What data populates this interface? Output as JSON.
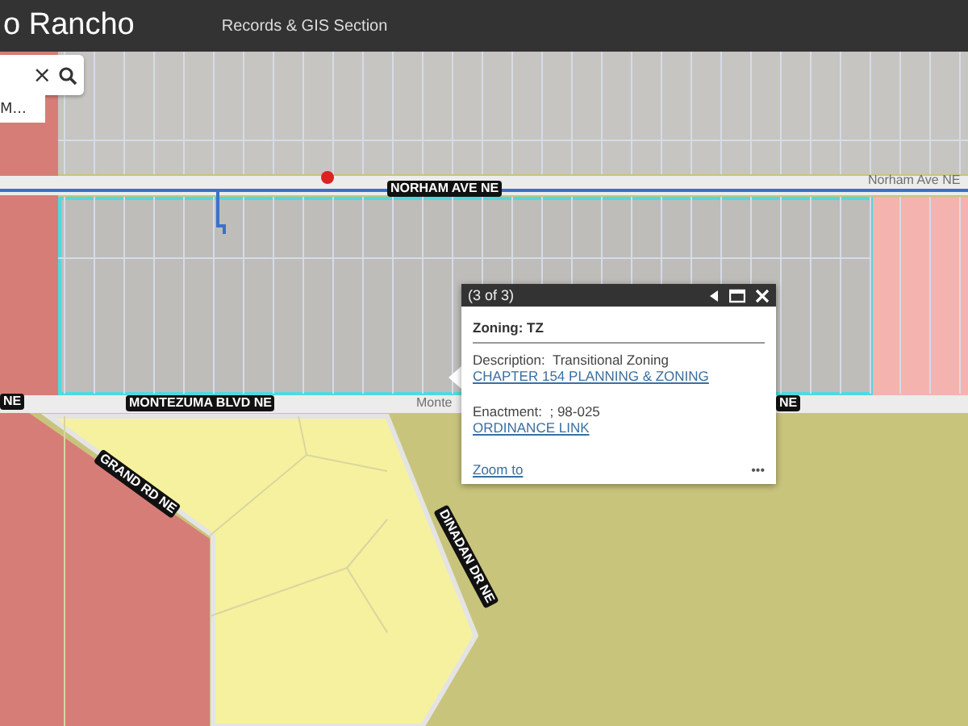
{
  "header": {
    "title": "o Rancho",
    "section": "Records & GIS Section"
  },
  "search": {
    "clear": "×",
    "suggestion": "M..."
  },
  "road_labels": [
    {
      "text": "NORHAM AVE NE",
      "kind": "boxed"
    },
    {
      "text": "Norham Ave NE",
      "kind": "faint"
    },
    {
      "text": "NE",
      "kind": "boxed"
    },
    {
      "text": "MONTEZUMA BLVD NE",
      "kind": "boxed"
    },
    {
      "text": "Monte",
      "kind": "faint"
    },
    {
      "text": "NE",
      "kind": "boxed"
    },
    {
      "text": "GRAND RD NE",
      "kind": "boxed"
    },
    {
      "text": "DINADAN DR NE",
      "kind": "boxed"
    }
  ],
  "popup": {
    "counter": "(3 of 3)",
    "title": "Zoning: TZ",
    "description_label": "Description:",
    "description": "Transitional Zoning",
    "chapter_link": "CHAPTER 154 PLANNING & ZONING",
    "enactment_label": "Enactment:",
    "enactment": "; 98-025",
    "ordinance_link": "ORDINANCE LINK",
    "zoom_link": "Zoom to",
    "more": "•••"
  }
}
